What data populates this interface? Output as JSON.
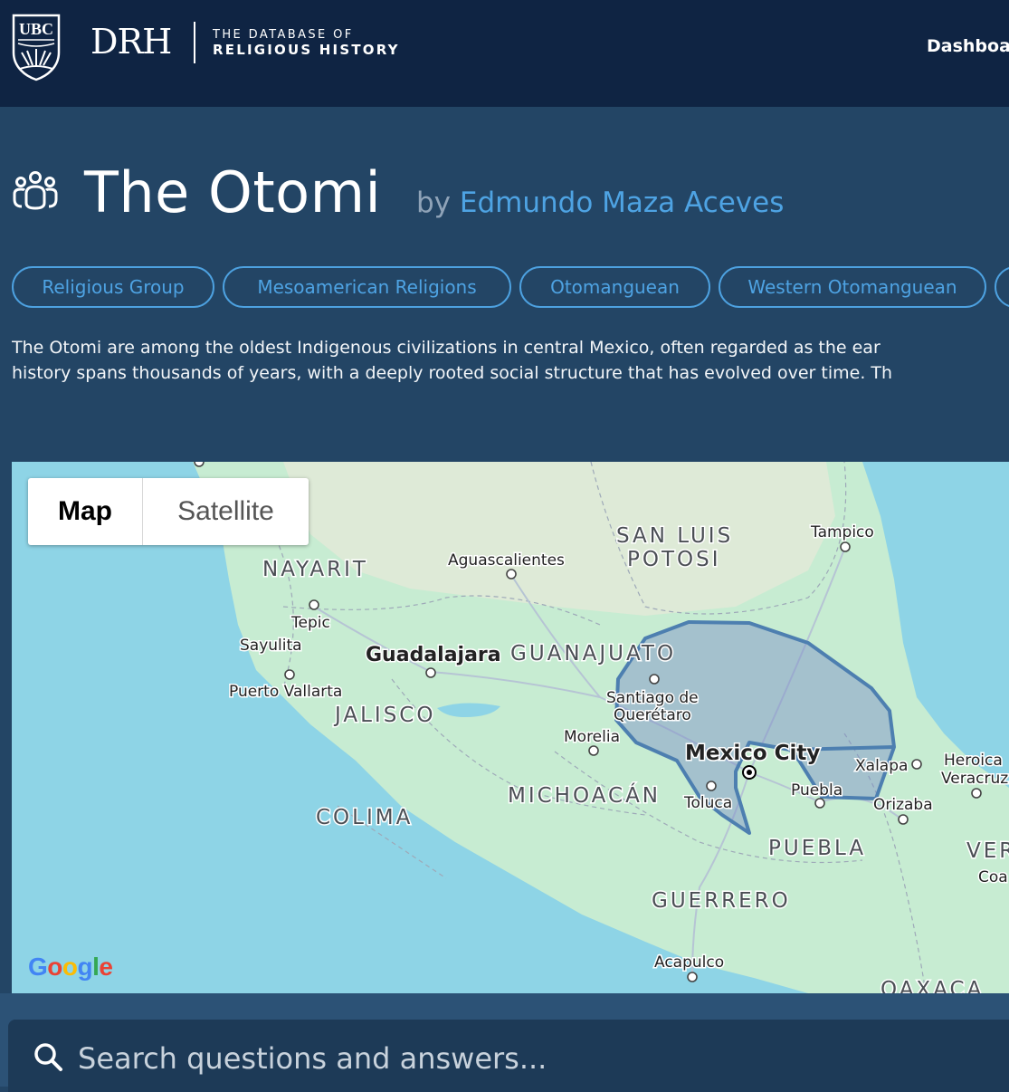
{
  "header": {
    "crest_text": "UBC",
    "logo": "DRH",
    "logo_sub_line1": "THE DATABASE OF",
    "logo_sub_line2": "RELIGIOUS HISTORY",
    "nav_dashboard": "Dashboa"
  },
  "entry": {
    "title": "The Otomi",
    "by": "by",
    "author": "Edmundo Maza Aceves",
    "tags": [
      "Religious Group",
      "Mesoamerican Religions",
      "Otomanguean",
      "Western Otomanguean"
    ],
    "description_line1": "The Otomi are among the oldest Indigenous civilizations in central Mexico, often regarded as the ear",
    "description_line2": "history spans thousands of years, with a deeply rooted social structure that has evolved over time. Th"
  },
  "map": {
    "tab_map": "Map",
    "tab_satellite": "Satellite",
    "selected_tab": "Map",
    "state_labels": {
      "nayarit": "NAYARIT",
      "san_luis_1": "SAN LUIS",
      "san_luis_2": "POTOSI",
      "guanajuato": "GUANAJUATO",
      "jalisco": "JALISCO",
      "michoacan": "MICHOACÁN",
      "colima": "COLIMA",
      "puebla": "PUEBLA",
      "guerrero": "GUERRERO",
      "oaxaca": "OAXACA",
      "ver": "VER"
    },
    "city_labels": {
      "aguascalientes": "Aguascalientes",
      "tampico": "Tampico",
      "tepic": "Tepic",
      "sayulita": "Sayulita",
      "puerto_vallarta": "Puerto Vallarta",
      "guadalajara": "Guadalajara",
      "santiago_1": "Santiago de",
      "santiago_2": "Querétaro",
      "morelia": "Morelia",
      "mexico_city": "Mexico City",
      "toluca": "Toluca",
      "puebla_city": "Puebla",
      "xalapa": "Xalapa",
      "orizaba": "Orizaba",
      "heroica_1": "Heroica",
      "heroica_2": "Veracruz",
      "coa": "Coa",
      "acapulco": "Acapulco"
    },
    "google_letters": [
      "G",
      "o",
      "o",
      "g",
      "l",
      "e"
    ],
    "colors": {
      "ocean": "#8ed4e6",
      "land": "#c7ecd2",
      "polygon_fill": "#7b8ec7",
      "polygon_stroke": "#4d7fb0"
    }
  },
  "search": {
    "placeholder": "Search questions and answers..."
  }
}
